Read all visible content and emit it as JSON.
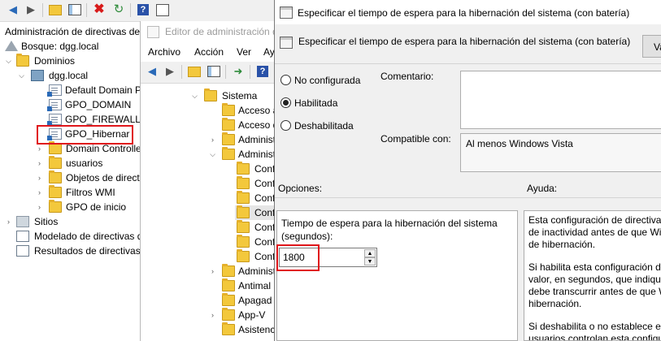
{
  "back_window": {
    "toolbar_icons": [
      "back-arrow-icon",
      "forward-arrow-icon",
      "up-folder-icon",
      "show-tree-icon",
      "delete-icon",
      "refresh-icon",
      "help-icon",
      "properties-icon"
    ],
    "tree": {
      "root": "Administración de directivas de",
      "forest": "Bosque: dgg.local",
      "domains": "Dominios",
      "domain": "dgg.local",
      "gpos": [
        "Default Domain P",
        "GPO_DOMAIN",
        "GPO_FIREWALL",
        "GPO_Hibernar"
      ],
      "folders": [
        "Domain Controlle",
        "usuarios",
        "Objetos de direct",
        "Filtros WMI",
        "GPO de inicio"
      ],
      "sites": "Sitios",
      "modeling": "Modelado de directivas d",
      "results": "Resultados de directivas"
    },
    "highlight_color": "#e0161b"
  },
  "editor": {
    "title": "Editor de administración d",
    "menu": [
      "Archivo",
      "Acción",
      "Ver",
      "Ay"
    ],
    "tree": {
      "root": "Sistema",
      "items": [
        "Acceso a",
        "Acceso d",
        "Administ",
        "Administ",
        "Conf",
        "Conf",
        "Conf",
        "Conf",
        "Conf",
        "Conf",
        "Conf",
        "Administ",
        "Antimal",
        "Apagad",
        "App-V",
        "Asistenc"
      ]
    }
  },
  "dialog": {
    "window_title": "Especificar el tiempo de espera para la hibernación del sistema (con batería)",
    "header_title": "Especificar el tiempo de espera para la hibernación del sistema (con batería)",
    "header_button": "Va",
    "radios": {
      "not_configured": "No configurada",
      "enabled": "Habilitada",
      "disabled": "Deshabilitada",
      "selected": "enabled"
    },
    "comment_label": "Comentario:",
    "compat_label": "Compatible con:",
    "compat_value": "Al menos Windows Vista",
    "options_label": "Opciones:",
    "help_label": "Ayuda:",
    "option_label_line1": "Tiempo de espera para la hibernación del sistema",
    "option_label_line2": "(segundos):",
    "option_value": "1800",
    "help_paragraphs": [
      [
        "Esta configuración de directiva",
        "de inactividad antes de que Wi",
        "de hibernación."
      ],
      [
        "Si habilita esta configuración d",
        "valor, en segundos, que indique",
        "debe transcurrir antes de que W",
        "hibernación."
      ],
      [
        "Si deshabilita o no establece es",
        "usuarios controlan esta configu"
      ]
    ]
  }
}
